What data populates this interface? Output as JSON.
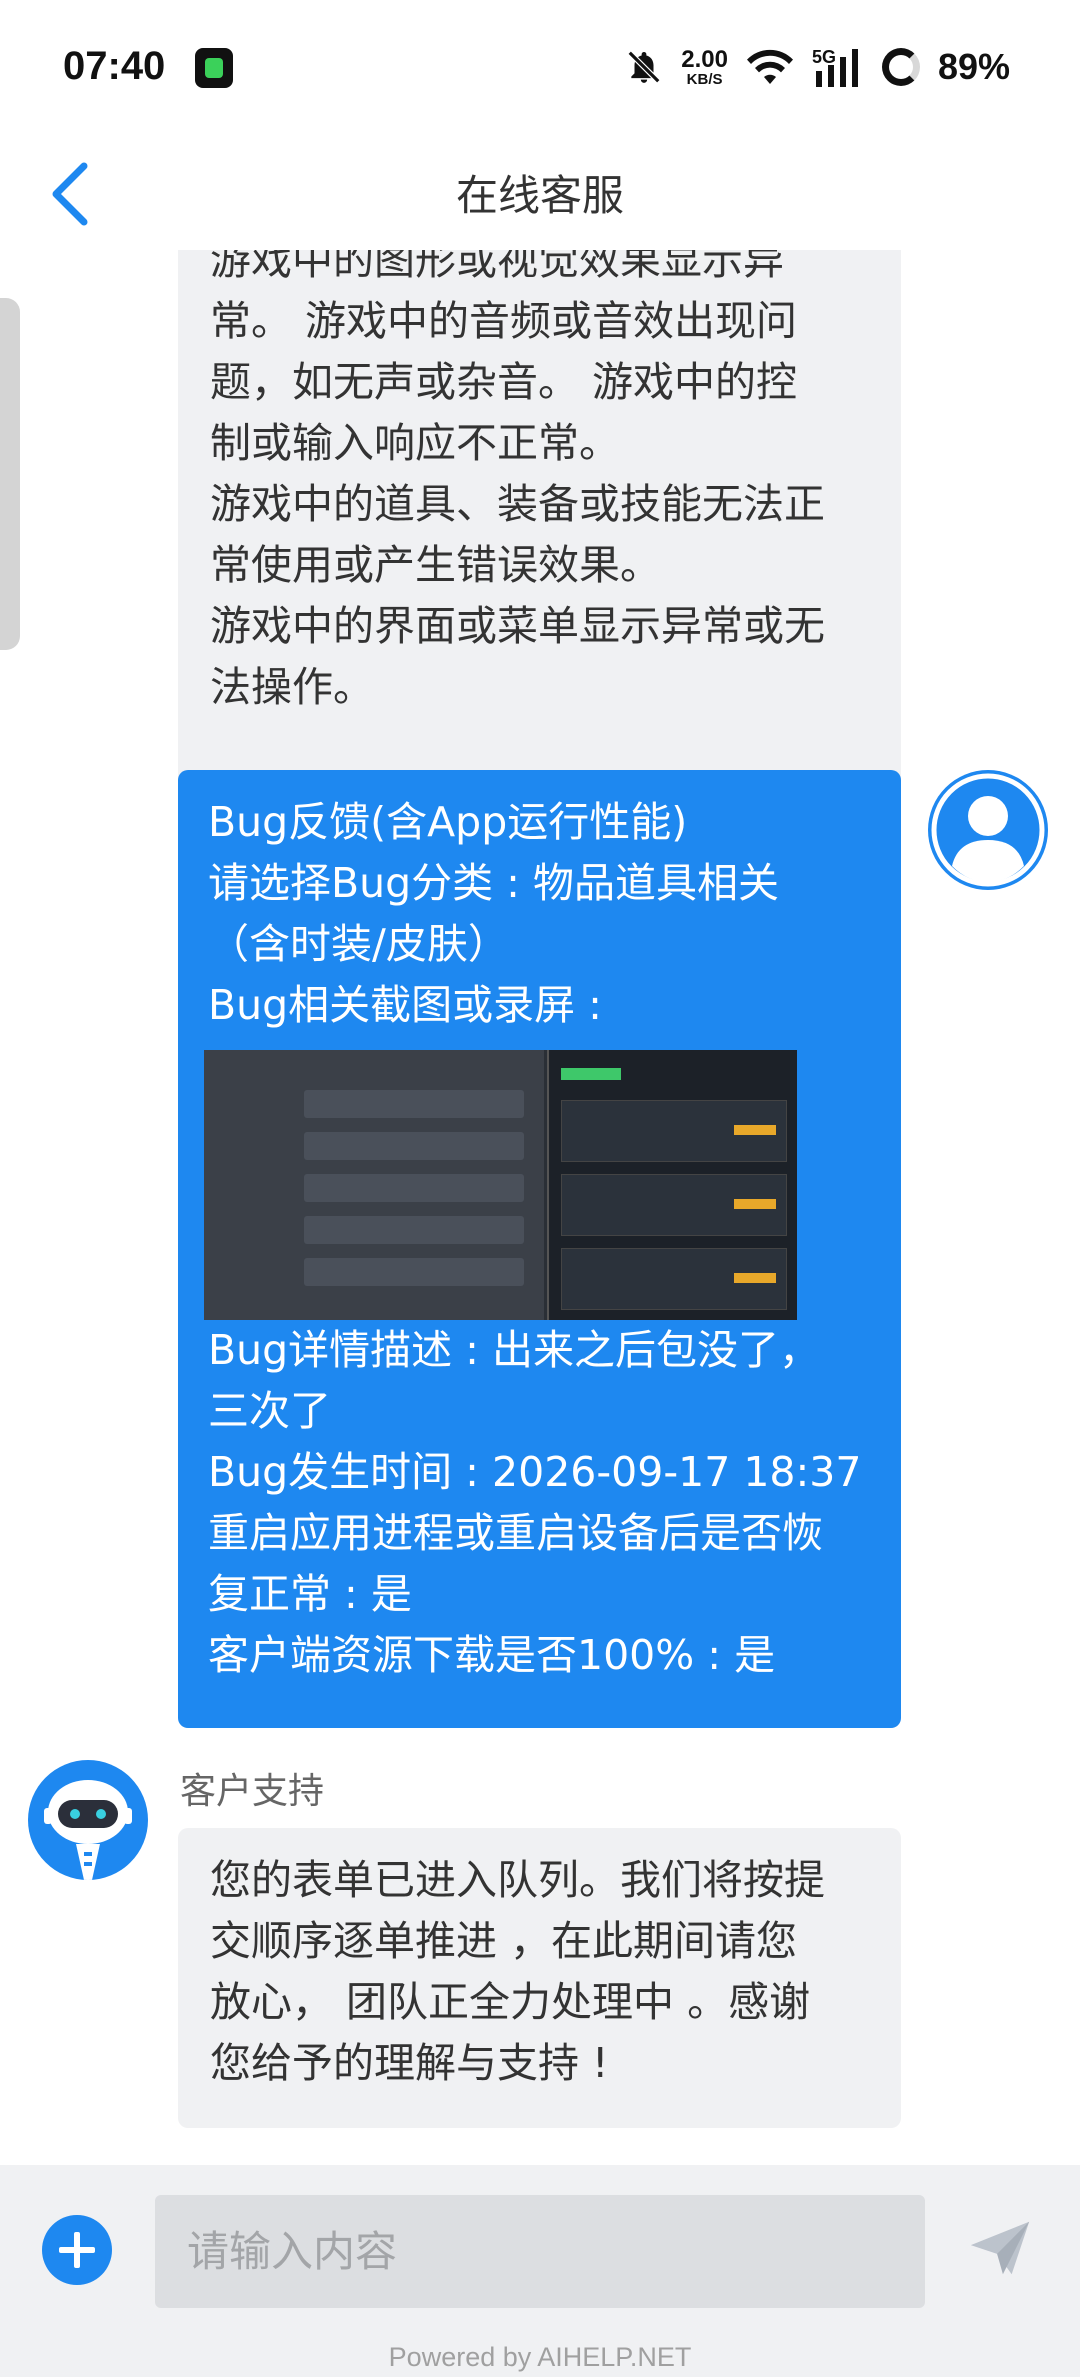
{
  "status_bar": {
    "time": "07:40",
    "net_speed": "2.00",
    "net_speed_unit": "KB/S",
    "network": "5G",
    "battery_percent": "89%"
  },
  "header": {
    "title": "在线客服"
  },
  "messages": {
    "prev_bot": {
      "lines": [
        "游戏中的图形或视觉效果显示异",
        "常。 游戏中的音频或音效出现问",
        "题，如无声或杂音。 游戏中的控",
        "制或输入响应不正常。",
        "游戏中的道具、装备或技能无法正",
        "常使用或产生错误效果。",
        "游戏中的界面或菜单显示异常或无",
        "法操作。"
      ]
    },
    "user_form": {
      "line1": "Bug反馈(含App运行性能)",
      "line2": "请选择Bug分类 : 物品道具相关",
      "line3": "（含时装/皮肤）",
      "line4": "Bug相关截图或录屏 :",
      "line5": "Bug详情描述 : 出来之后包没了，",
      "line6": "三次了",
      "line7": "Bug发生时间 : 2026-09-17 18:37",
      "line8": "重启应用进程或重启设备后是否恢",
      "line9": "复正常 : 是",
      "line10": "客户端资源下载是否100% : 是"
    },
    "bot_reply": {
      "sender": "客户支持",
      "lines": [
        "您的表单已进入队列。我们将按提",
        "交顺序逐单推进 ，在此期间请您",
        "放心， 团队正全力处理中 。感谢",
        "您给予的理解与支持 !"
      ]
    }
  },
  "input": {
    "placeholder": "请输入内容"
  },
  "footer": {
    "powered_by": "Powered by AIHELP.NET"
  },
  "colors": {
    "accent": "#1e88f0",
    "bubble_gray": "#f0f1f3",
    "input_bar": "#f0f1f3"
  }
}
